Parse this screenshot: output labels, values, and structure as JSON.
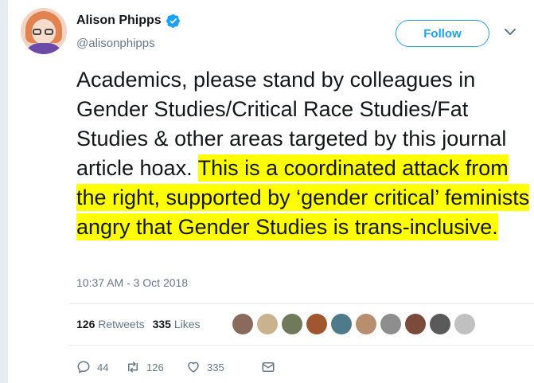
{
  "author": {
    "name": "Alison Phipps",
    "handle": "@alisonphipps",
    "verified": true
  },
  "follow_label": "Follow",
  "tweet": {
    "text_plain": "Academics, please stand by colleagues in Gender Studies/Critical Race Studies/Fat Studies & other areas targeted by this journal article hoax. ",
    "text_highlighted": "This is a coordinated attack from the right, supported by ‘gender critical’ feminists angry that Gender Studies is trans-inclusive.",
    "highlight_color": "#ffff00"
  },
  "timestamp": "10:37 AM - 3 Oct 2018",
  "stats": {
    "retweets_count": "126",
    "retweets_label": "Retweets",
    "likes_count": "335",
    "likes_label": "Likes"
  },
  "actions": {
    "reply_count": "44",
    "retweet_count": "126",
    "like_count": "335"
  },
  "icons": [
    "verified-badge-icon",
    "chevron-down-icon",
    "reply-icon",
    "retweet-icon",
    "like-icon",
    "message-icon"
  ],
  "colors": {
    "accent": "#1da1f2",
    "secondary_text": "#657786",
    "divider": "#e6ecf0"
  }
}
